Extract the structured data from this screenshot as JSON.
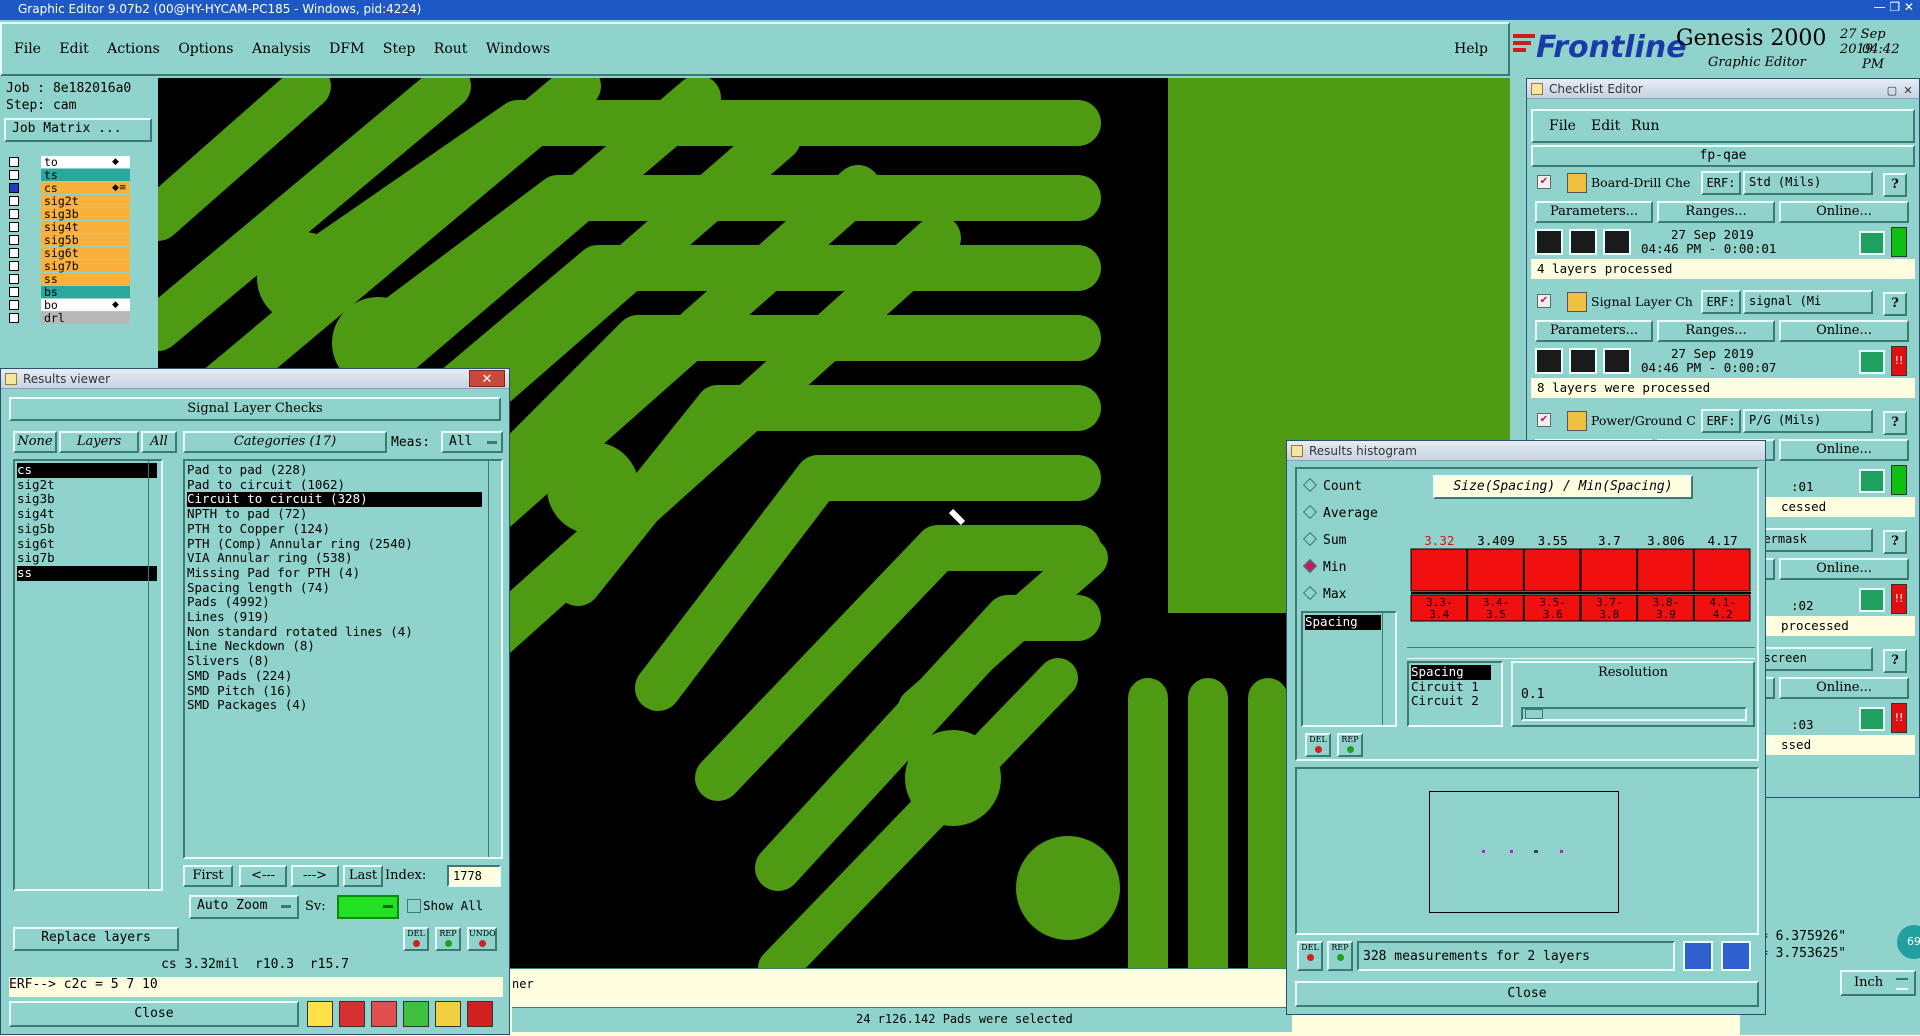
{
  "os_title": "Graphic Editor 9.07b2 (00@HY-HYCAM-PC185 - Windows, pid:4224)",
  "menubar": [
    "File",
    "Edit",
    "Actions",
    "Options",
    "Analysis",
    "DFM",
    "Step",
    "Rout",
    "Windows"
  ],
  "help_label": "Help",
  "brand": {
    "logo": "Frontline",
    "product": "Genesis 2000",
    "subtitle": "Graphic Editor",
    "date": "27 Sep 2019",
    "time": "04:42 PM"
  },
  "job": {
    "job_line": "Job : 8e182016a0",
    "step_line": "Step: cam",
    "matrix_button": "Job Matrix ..."
  },
  "layers": [
    {
      "name": "to",
      "style": "white",
      "mark": "◆"
    },
    {
      "name": "ts",
      "style": "teal",
      "mark": ""
    },
    {
      "name": "cs",
      "style": "orange",
      "mark": "◆≡"
    },
    {
      "name": "sig2t",
      "style": "orange",
      "mark": ""
    },
    {
      "name": "sig3b",
      "style": "orange",
      "mark": ""
    },
    {
      "name": "sig4t",
      "style": "orange",
      "mark": ""
    },
    {
      "name": "sig5b",
      "style": "orange",
      "mark": ""
    },
    {
      "name": "sig6t",
      "style": "orange",
      "mark": ""
    },
    {
      "name": "sig7b",
      "style": "orange",
      "mark": ""
    },
    {
      "name": "ss",
      "style": "orange",
      "mark": ""
    },
    {
      "name": "bs",
      "style": "teal",
      "mark": ""
    },
    {
      "name": "bo",
      "style": "white",
      "mark": "◆"
    },
    {
      "name": "drl",
      "style": "gray",
      "mark": ""
    }
  ],
  "results_viewer": {
    "title": "Results viewer",
    "header": "Signal Layer Checks",
    "none_btn": "None",
    "layers_btn": "Layers",
    "all_btn": "All",
    "categories_btn": "Categories (17)",
    "meas_label": "Meas:",
    "meas_value": "All",
    "layer_list": [
      "cs",
      "sig2t",
      "sig3b",
      "sig4t",
      "sig5b",
      "sig6t",
      "sig7b",
      "ss"
    ],
    "categories": [
      "Pad to pad (228)",
      "Pad to circuit (1062)",
      "Circuit to circuit (328)",
      "NPTH to pad (72)",
      "PTH to Copper (124)",
      "PTH (Comp) Annular ring (2540)",
      "VIA Annular ring (538)",
      "Missing Pad for PTH (4)",
      "Spacing length (74)",
      "Pads (4992)",
      "Lines (919)",
      "Non standard rotated lines (4)",
      "Line Neckdown (8)",
      "Slivers (8)",
      "SMD Pads (224)",
      "SMD Pitch (16)",
      "SMD Packages (4)"
    ],
    "nav": {
      "first": "First",
      "prev": "<---",
      "next": "--->",
      "last": "Last",
      "index_label": "Index:",
      "index_value": "1778"
    },
    "auto_zoom": "Auto Zoom",
    "sv_label": "Sv:",
    "show_all": "Show All",
    "replace_layers": "Replace layers",
    "small_buttons": [
      "DEL",
      "REP",
      "UNDO"
    ],
    "status": "cs 3.32mil  r10.3  r15.7",
    "erf_line": "ERF--> c2c = 5 7 10",
    "close": "Close"
  },
  "status_bar": {
    "message": "24 r126.142 Pads were selected",
    "partial_left": "ner",
    "units": "Inch",
    "coord_x": "= 6.375926\"",
    "coord_y": "= 3.753625\"",
    "badge": "69"
  },
  "checklist": {
    "title": "Checklist Editor",
    "menu": [
      "File",
      "Edit",
      "Run"
    ],
    "name": "fp-qae",
    "erf_label": "ERF:",
    "params_label": "Parameters...",
    "ranges_label": "Ranges...",
    "online_label": "Online...",
    "items": [
      {
        "name": "Board-Drill Che",
        "erf": "Std (Mils)",
        "date": "27 Sep 2019",
        "time": "04:46 PM - 0:00:01",
        "msg": "4 layers processed",
        "status": "green"
      },
      {
        "name": "Signal Layer Ch",
        "erf": "signal (Mi",
        "date": "27 Sep 2019",
        "time": "04:46 PM - 0:00:07",
        "msg": "8 layers were processed",
        "status": "red"
      },
      {
        "name": "Power/Ground C",
        "erf": "P/G (Mils)",
        "date": "",
        "time": ":01",
        "msg": "cessed",
        "status": "green"
      },
      {
        "name": "",
        "erf": "ldermask",
        "date": "",
        "time": ":02",
        "msg": "processed",
        "status": "red"
      },
      {
        "name": "",
        "erf": "lkscreen",
        "date": "",
        "time": ":03",
        "msg": "ssed",
        "status": "red"
      }
    ]
  },
  "histogram": {
    "title": "Results histogram",
    "modes": [
      "Count",
      "Average",
      "Sum",
      "Min",
      "Max"
    ],
    "selected_mode": "Min",
    "chart_title": "Size(Spacing) / Min(Spacing)",
    "bins": [
      {
        "value": "3.32",
        "range1": "3.3-",
        "range2": "3.4"
      },
      {
        "value": "3.409",
        "range1": "3.4-",
        "range2": "3.5"
      },
      {
        "value": "3.55",
        "range1": "3.5-",
        "range2": "3.6"
      },
      {
        "value": "3.7",
        "range1": "3.7-",
        "range2": "3.8"
      },
      {
        "value": "3.806",
        "range1": "3.8-",
        "range2": "3.9"
      },
      {
        "value": "4.17",
        "range1": "4.1-",
        "range2": "4.2"
      }
    ],
    "left_list": [
      "Spacing"
    ],
    "sub_list": [
      "Spacing",
      "Circuit 1",
      "Circuit 2"
    ],
    "resolution_label": "Resolution",
    "resolution_value": "0.1",
    "small_buttons": [
      "DEL",
      "REP"
    ],
    "footer": "328 measurements for 2 layers",
    "close": "Close"
  },
  "colors": {
    "board": "#000000",
    "copper": "#4e9a12",
    "panel": "#8fd3cc",
    "bar": "#f01010",
    "layer_orange": "#f9b13c"
  }
}
